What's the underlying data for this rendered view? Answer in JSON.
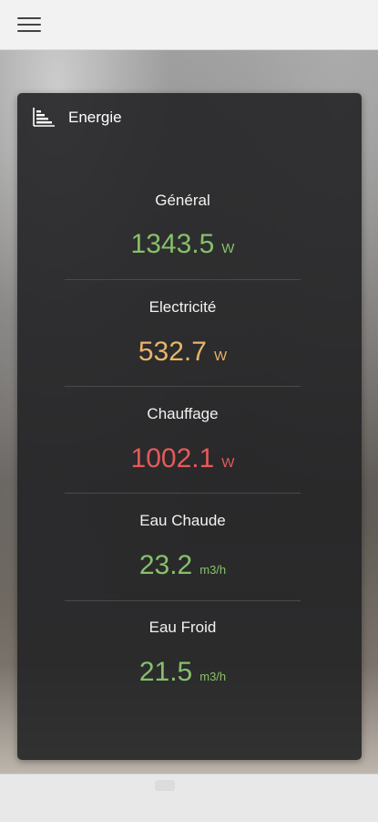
{
  "header": {
    "menu_icon": "hamburger-menu-icon"
  },
  "card": {
    "title": "Energie",
    "icon": "energy-rating-bars-icon"
  },
  "metrics": [
    {
      "label": "Général",
      "value": "1343.5",
      "unit": "W",
      "color": "#86c06a"
    },
    {
      "label": "Electricité",
      "value": "532.7",
      "unit": "W",
      "color": "#e8b567"
    },
    {
      "label": "Chauffage",
      "value": "1002.1",
      "unit": "W",
      "color": "#e45b5b"
    },
    {
      "label": "Eau Chaude",
      "value": "23.2",
      "unit": "m3/h",
      "color": "#86c06a"
    },
    {
      "label": "Eau Froid",
      "value": "21.5",
      "unit": "m3/h",
      "color": "#86c06a"
    }
  ]
}
